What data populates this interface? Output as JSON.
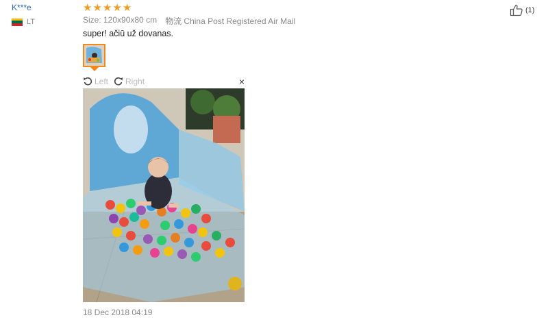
{
  "review": {
    "user_name": "K***e",
    "country_code": "LT",
    "flag_colors": [
      "#fdb913",
      "#006a44",
      "#c1272d"
    ],
    "rating": 5,
    "star_glyph": "★",
    "size_text": "Size: 120x90x80 cm",
    "shipping_label": "物流",
    "shipping_value": "China Post Registered Air Mail",
    "text": "super! ačiū už dovanas.",
    "date": "18 Dec 2018 04:19",
    "helpful_count": "(1)"
  },
  "viewer": {
    "rotate_left_label": "Left",
    "rotate_right_label": "Right",
    "close_glyph": "×"
  },
  "colors": {
    "accent": "#f0891e",
    "star": "#f29b1d",
    "link": "#2a66b5"
  }
}
